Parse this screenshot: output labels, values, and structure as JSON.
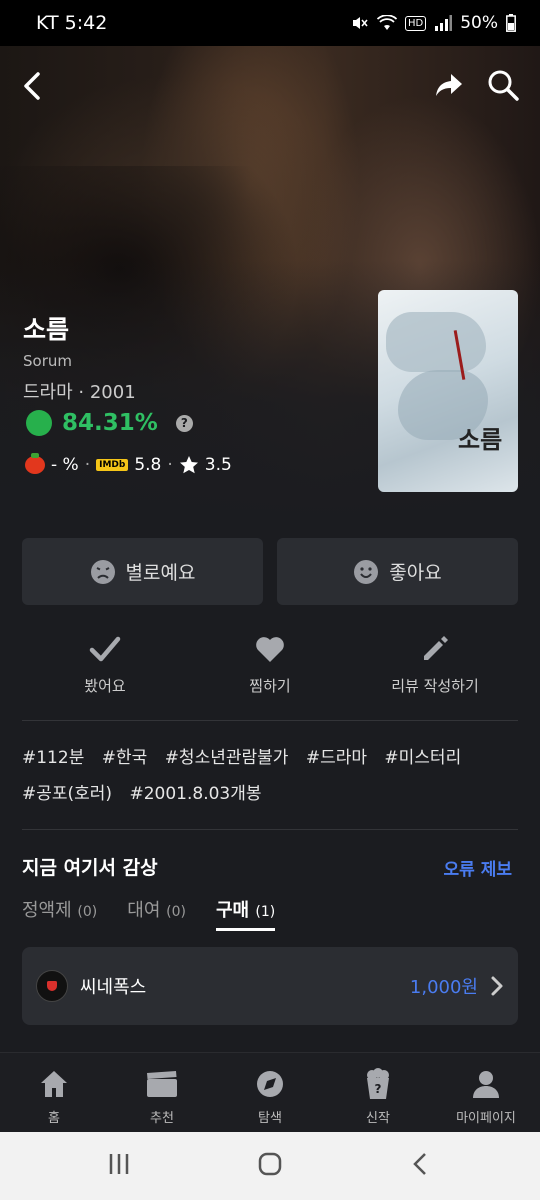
{
  "status_bar": {
    "carrier_time": "KT 5:42",
    "hd": "HD",
    "battery": "50%"
  },
  "movie": {
    "title": "소름",
    "original_title": "Sorum",
    "genre_year": "드라마 · 2001",
    "score": "84.31%",
    "score_help": "?",
    "tomato_score": "- %",
    "imdb_label": "IMDb",
    "imdb_score": "5.8",
    "star_score": "3.5",
    "poster_title": "소름"
  },
  "rating_buttons": {
    "dislike": "별로예요",
    "like": "좋아요"
  },
  "actions": {
    "watched": "봤어요",
    "wish": "찜하기",
    "review": "리뷰 작성하기"
  },
  "tags": [
    "#112분",
    "#한국",
    "#청소년관람불가",
    "#드라마",
    "#미스터리",
    "#공포(호러)",
    "#2001.8.03개봉"
  ],
  "watch": {
    "title": "지금 여기서 감상",
    "report": "오류 제보",
    "tabs": [
      {
        "label": "정액제",
        "count": "(0)"
      },
      {
        "label": "대여",
        "count": "(0)"
      },
      {
        "label": "구매",
        "count": "(1)"
      }
    ],
    "provider": {
      "name": "씨네폭스",
      "price": "1,000원"
    }
  },
  "bottom_nav": [
    "홈",
    "추천",
    "탐색",
    "신작",
    "마이페이지"
  ],
  "colors": {
    "score_green": "#2fbf63",
    "accent_blue": "#4a7cf0"
  }
}
